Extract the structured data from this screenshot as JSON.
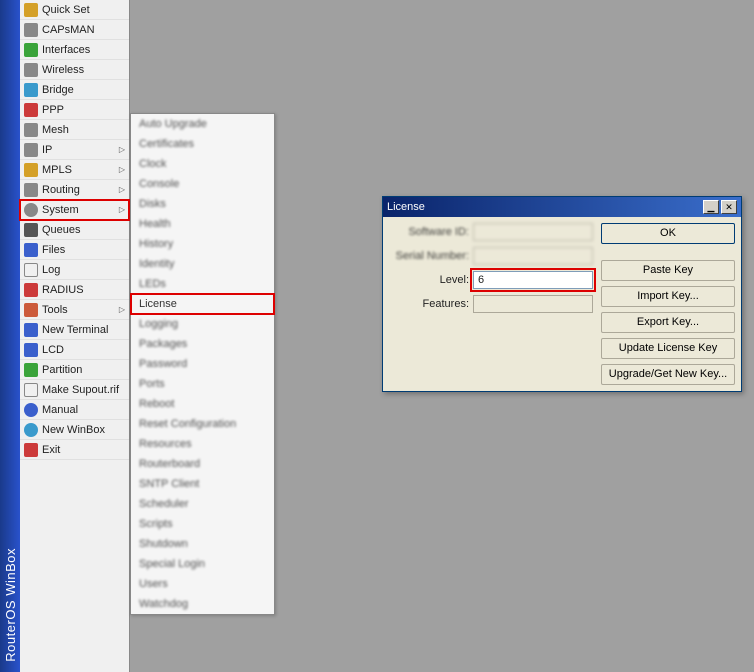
{
  "app_title": "RouterOS WinBox",
  "menu": {
    "items": [
      {
        "label": "Quick Set",
        "arrow": false
      },
      {
        "label": "CAPsMAN",
        "arrow": false
      },
      {
        "label": "Interfaces",
        "arrow": false
      },
      {
        "label": "Wireless",
        "arrow": false
      },
      {
        "label": "Bridge",
        "arrow": false
      },
      {
        "label": "PPP",
        "arrow": false
      },
      {
        "label": "Mesh",
        "arrow": false
      },
      {
        "label": "IP",
        "arrow": true
      },
      {
        "label": "MPLS",
        "arrow": true
      },
      {
        "label": "Routing",
        "arrow": true
      },
      {
        "label": "System",
        "arrow": true,
        "highlight": true
      },
      {
        "label": "Queues",
        "arrow": false
      },
      {
        "label": "Files",
        "arrow": false
      },
      {
        "label": "Log",
        "arrow": false
      },
      {
        "label": "RADIUS",
        "arrow": false
      },
      {
        "label": "Tools",
        "arrow": true
      },
      {
        "label": "New Terminal",
        "arrow": false
      },
      {
        "label": "LCD",
        "arrow": false
      },
      {
        "label": "Partition",
        "arrow": false
      },
      {
        "label": "Make Supout.rif",
        "arrow": false
      },
      {
        "label": "Manual",
        "arrow": false
      },
      {
        "label": "New WinBox",
        "arrow": false
      },
      {
        "label": "Exit",
        "arrow": false
      }
    ]
  },
  "submenu": {
    "items": [
      "Auto Upgrade",
      "Certificates",
      "Clock",
      "Console",
      "Disks",
      "Health",
      "History",
      "Identity",
      "LEDs",
      "License",
      "Logging",
      "Packages",
      "Password",
      "Ports",
      "Reboot",
      "Reset Configuration",
      "Resources",
      "Routerboard",
      "SNTP Client",
      "Scheduler",
      "Scripts",
      "Shutdown",
      "Special Login",
      "Users",
      "Watchdog"
    ],
    "highlight_index": 9
  },
  "dialog": {
    "title": "License",
    "labels": {
      "software_id": "Software ID:",
      "serial_number": "Serial Number:",
      "level": "Level:",
      "features": "Features:"
    },
    "values": {
      "software_id": "",
      "serial_number": "",
      "level": "6",
      "features": ""
    },
    "buttons": {
      "ok": "OK",
      "paste": "Paste Key",
      "import": "Import Key...",
      "export": "Export Key...",
      "update": "Update License Key",
      "upgrade": "Upgrade/Get New Key..."
    }
  }
}
